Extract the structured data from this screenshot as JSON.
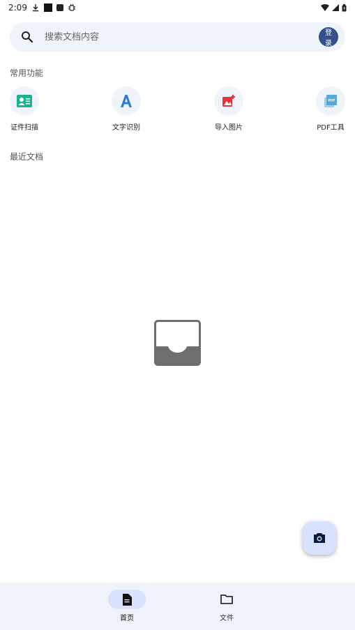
{
  "status_bar": {
    "time": "2:09"
  },
  "search": {
    "placeholder": "搜索文档内容",
    "login_label": "登录"
  },
  "sections": {
    "common": "常用功能",
    "recent": "最近文档"
  },
  "features": [
    {
      "label": "证件扫描",
      "icon": "id-card-icon"
    },
    {
      "label": "文字识别",
      "icon": "text-recognition-icon"
    },
    {
      "label": "导入图片",
      "icon": "add-image-icon"
    },
    {
      "label": "PDF工具",
      "icon": "pdf-icon"
    }
  ],
  "bottom_nav": [
    {
      "label": "首页",
      "icon": "document-icon",
      "active": true
    },
    {
      "label": "文件",
      "icon": "folder-icon",
      "active": false
    }
  ],
  "colors": {
    "accent": "#34518c",
    "surface": "#eff3fa",
    "fab": "#d8e2ff",
    "id_card": "#1bb38a",
    "text_recog": "#2f77d8",
    "import_image": "#e5333b",
    "pdf": "#55a8d8"
  }
}
